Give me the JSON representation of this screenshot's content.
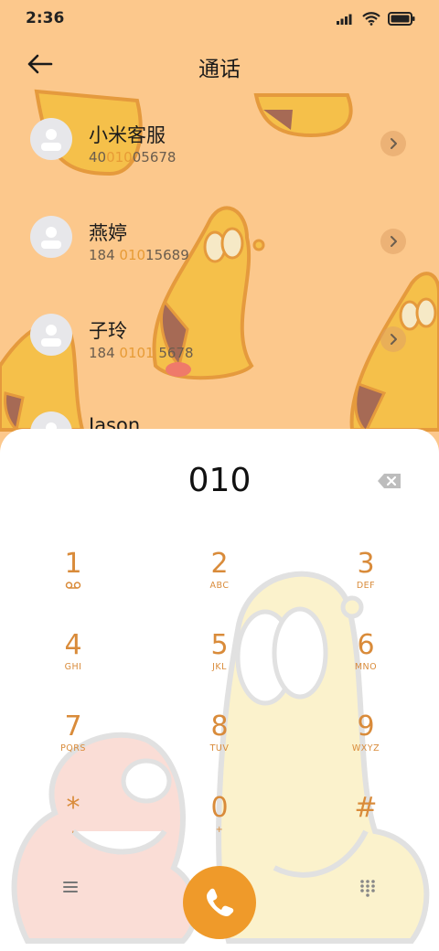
{
  "status_bar": {
    "time": "2:36"
  },
  "header": {
    "title": "通话"
  },
  "contacts": [
    {
      "name": "小米客服",
      "num_pre": "40",
      "num_hl": "010",
      "num_post": "05678"
    },
    {
      "name": "燕婷",
      "num_pre": "184 ",
      "num_hl": "010",
      "num_post": "15689"
    },
    {
      "name": "子玲",
      "num_pre": "184 ",
      "num_hl": "0101",
      "num_post": " 5678"
    },
    {
      "name": "Jason",
      "num_pre": "",
      "num_hl": "",
      "num_post": ""
    }
  ],
  "dialer": {
    "input": "010",
    "keys": [
      {
        "num": "1",
        "sub": "voicemail-icon"
      },
      {
        "num": "2",
        "sub": "ABC"
      },
      {
        "num": "3",
        "sub": "DEF"
      },
      {
        "num": "4",
        "sub": "GHI"
      },
      {
        "num": "5",
        "sub": "JKL"
      },
      {
        "num": "6",
        "sub": "MNO"
      },
      {
        "num": "7",
        "sub": "PQRS"
      },
      {
        "num": "8",
        "sub": "TUV"
      },
      {
        "num": "9",
        "sub": "WXYZ"
      },
      {
        "num": "*",
        "sub": ","
      },
      {
        "num": "0",
        "sub": "+"
      },
      {
        "num": "#",
        "sub": ""
      }
    ]
  },
  "colors": {
    "accent": "#ef9a2a",
    "key_text": "#d98b3a",
    "background": "#fcc88c",
    "highlight": "#e79b36"
  }
}
